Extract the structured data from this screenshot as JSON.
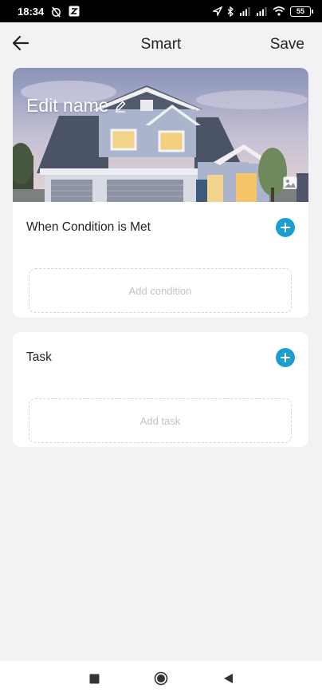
{
  "status_bar": {
    "time": "18:34",
    "battery": "55",
    "icons": [
      "alarm-off-icon",
      "app-notification-icon",
      "location-arrow-icon",
      "bluetooth-icon",
      "signal-icon",
      "signal-icon",
      "wifi-icon",
      "battery-icon"
    ]
  },
  "header": {
    "title": "Smart",
    "save_label": "Save",
    "back_icon": "arrow-left-icon"
  },
  "hero": {
    "edit_name_label": "Edit name",
    "edit_icon": "pencil-icon",
    "photo_icon": "image-icon"
  },
  "condition_section": {
    "title": "When Condition is Met",
    "placeholder": "Add condition"
  },
  "task_section": {
    "title": "Task",
    "placeholder": "Add task"
  },
  "nav": {
    "icons": [
      "recents-square-icon",
      "home-circle-icon",
      "back-triangle-icon"
    ]
  },
  "colors": {
    "accent": "#1a9fd0",
    "background": "#f2f2f4",
    "card": "#ffffff"
  }
}
